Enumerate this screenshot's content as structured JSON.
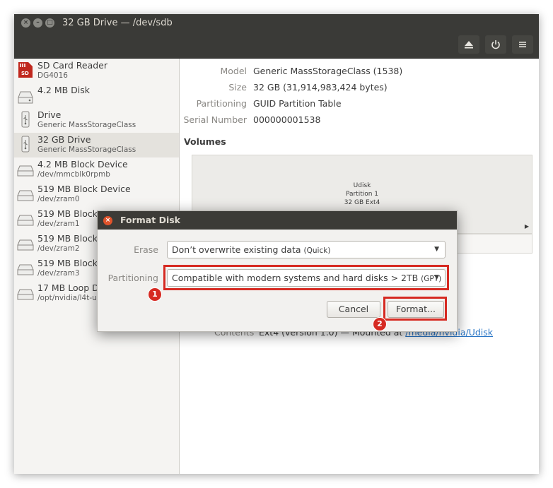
{
  "window": {
    "title": "32 GB Drive — /dev/sdb",
    "close_glyph": "×",
    "minimize_glyph": "–",
    "maximize_glyph": "□",
    "header_icons": [
      "eject-icon",
      "power-icon",
      "menu-icon"
    ]
  },
  "sidebar": {
    "items": [
      {
        "name": "SD Card Reader",
        "sub": "DG4016",
        "icon": "sd-card-icon"
      },
      {
        "name": "4.2 MB Disk",
        "sub": "",
        "icon": "disk-icon"
      },
      {
        "name": "Drive",
        "sub": "Generic MassStorageClass",
        "icon": "usb-drive-icon"
      },
      {
        "name": "32 GB Drive",
        "sub": "Generic MassStorageClass",
        "icon": "usb-drive-icon",
        "selected": true
      },
      {
        "name": "4.2 MB Block Device",
        "sub": "/dev/mmcblk0rpmb",
        "icon": "block-device-icon"
      },
      {
        "name": "519 MB Block Device",
        "sub": "/dev/zram0",
        "icon": "block-device-icon"
      },
      {
        "name": "519 MB Block",
        "sub": "/dev/zram1",
        "icon": "block-device-icon"
      },
      {
        "name": "519 MB Block",
        "sub": "/dev/zram2",
        "icon": "block-device-icon"
      },
      {
        "name": "519 MB Block",
        "sub": "/dev/zram3",
        "icon": "block-device-icon"
      },
      {
        "name": "17 MB Loop D",
        "sub": "/opt/nvidia/l4t-u",
        "icon": "block-device-icon"
      }
    ]
  },
  "details": {
    "model_label": "Model",
    "model_value": "Generic MassStorageClass (1538)",
    "size_label": "Size",
    "size_value": "32 GB (31,914,983,424 bytes)",
    "partitioning_label": "Partitioning",
    "partitioning_value": "GUID Partition Table",
    "serial_label": "Serial Number",
    "serial_value": "000000001538",
    "volumes_heading": "Volumes",
    "volume_name": "Udisk",
    "volume_partition": "Partition 1",
    "volume_size": "32 GB Ext4",
    "volume_arrow": "▶",
    "contents_label": "Contents",
    "contents_value": "Ext4 (version 1.0) — Mounted at ",
    "contents_link": "/media/nvidia/Udisk"
  },
  "dialog": {
    "title": "Format Disk",
    "close_glyph": "×",
    "erase_label": "Erase",
    "erase_value": "Don’t overwrite existing data",
    "erase_hint": "(Quick)",
    "partitioning_label": "Partitioning",
    "partitioning_value": "Compatible with modern systems and hard disks > 2TB",
    "partitioning_hint": "(GPT)",
    "dropdown_arrow": "▼",
    "cancel_label": "Cancel",
    "format_label": "Format..."
  },
  "annotations": {
    "badge1": "1",
    "badge2": "2",
    "highlight_color": "#d62a22"
  }
}
